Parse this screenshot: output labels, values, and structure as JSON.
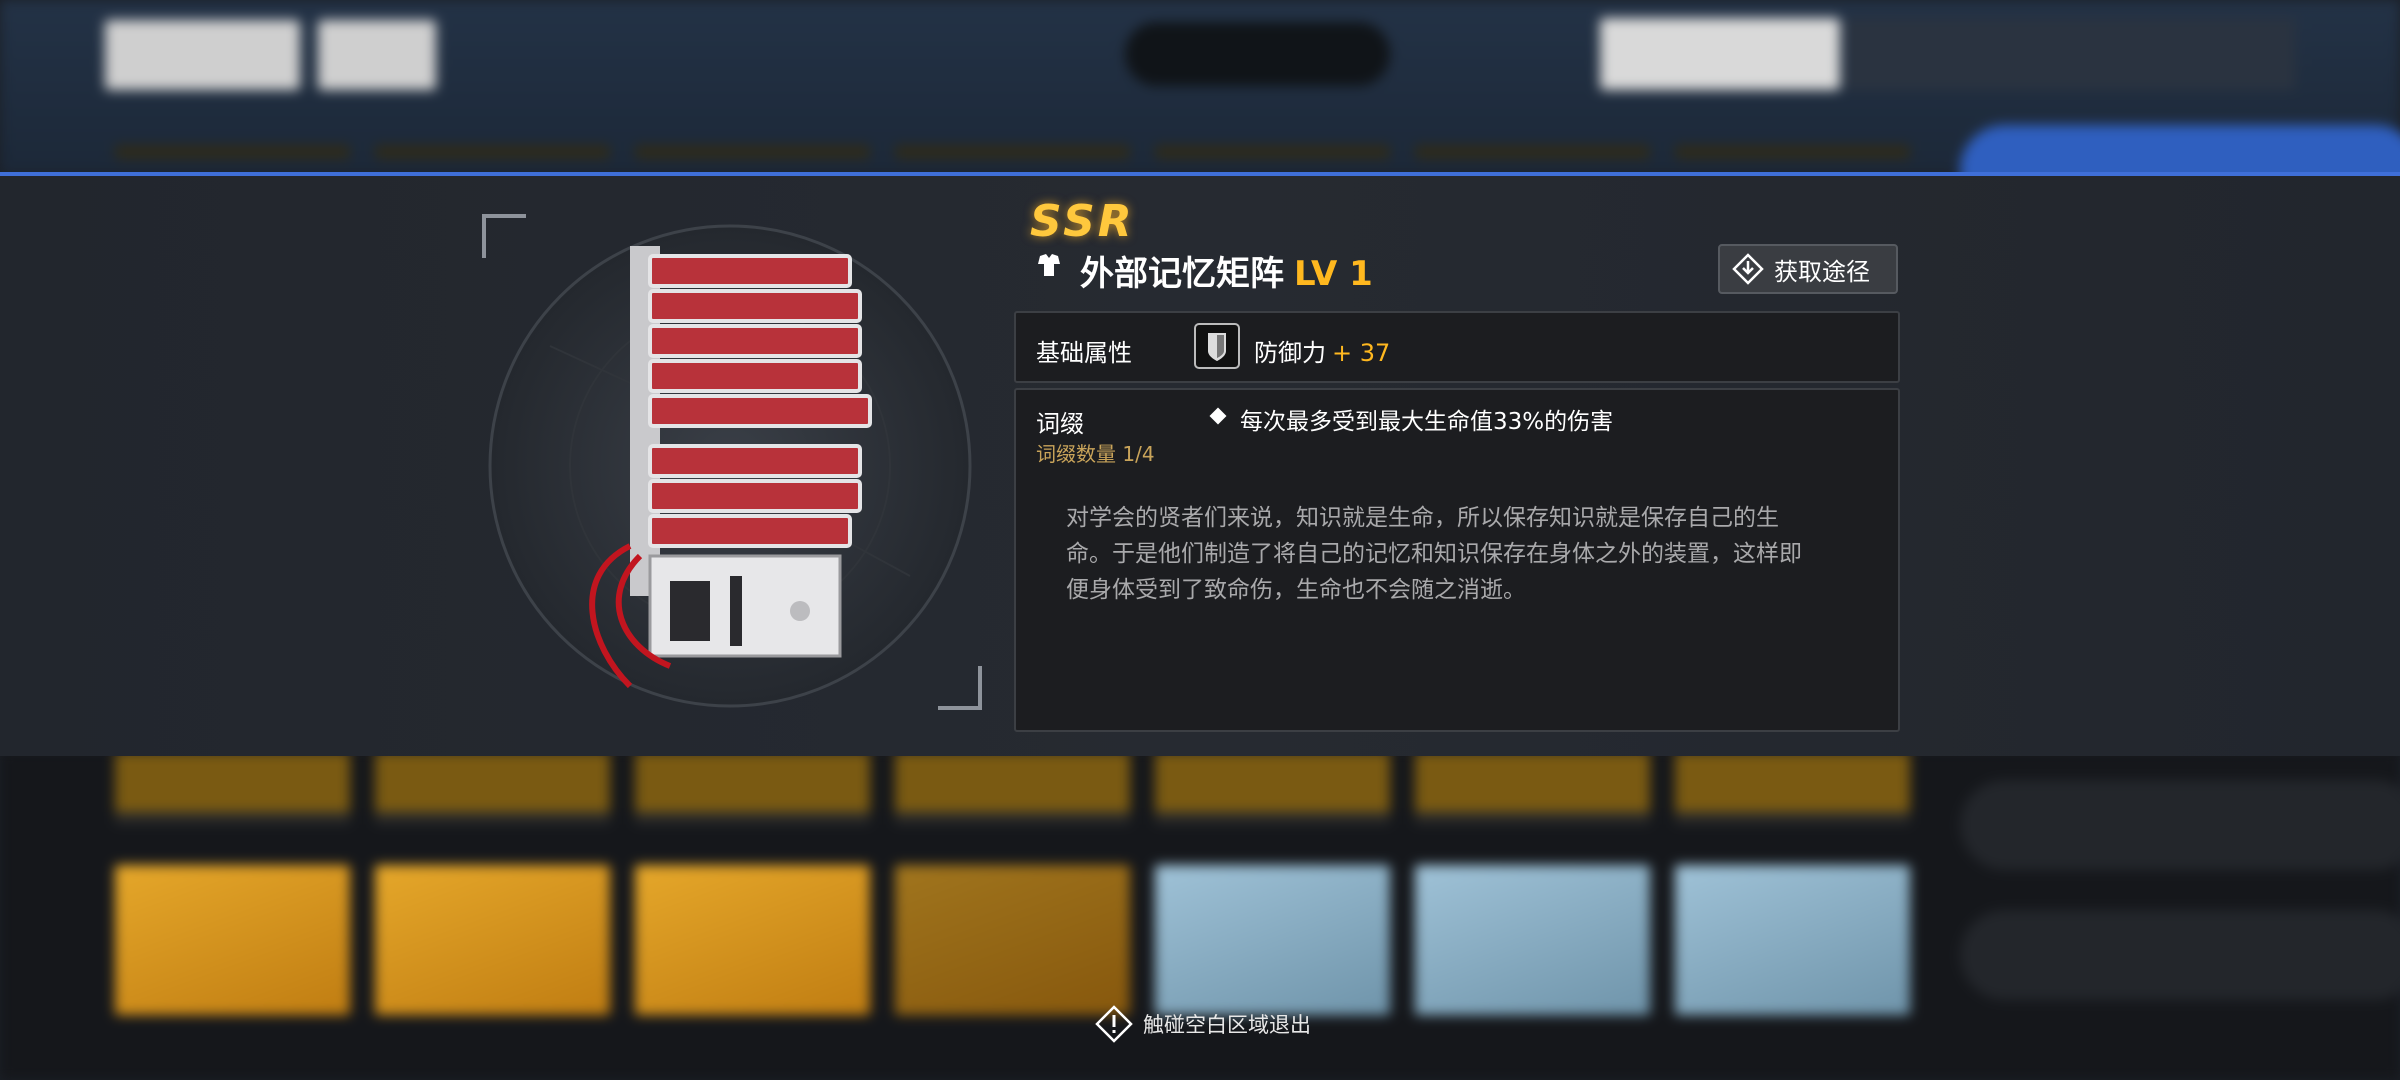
{
  "item": {
    "rarity": "SSR",
    "name": "外部记忆矩阵",
    "level": "LV 1",
    "source_button": "获取途径"
  },
  "base_attributes": {
    "label": "基础属性",
    "stat_name": "防御力",
    "stat_value": "+ 37"
  },
  "affix": {
    "label": "词缀",
    "count": "词缀数量 1/4",
    "effect": "每次最多受到最大生命值33%的伤害",
    "description": "对学会的贤者们来说，知识就是生命，所以保存知识就是保存自己的生命。于是他们制造了将自己的记忆和知识保存在身体之外的装置，这样即便身体受到了致命伤，生命也不会随之消逝。"
  },
  "footer": {
    "exit_hint": "触碰空白区域退出"
  },
  "colors": {
    "accent_blue": "#3f6fd8",
    "gold": "#ffb81f",
    "rarity_gold": "#ffc83d"
  }
}
